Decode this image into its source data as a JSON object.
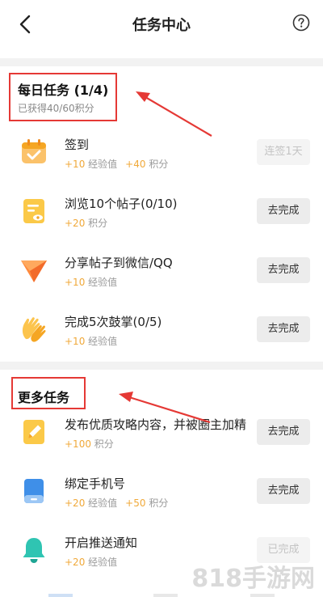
{
  "header": {
    "title": "任务中心"
  },
  "daily": {
    "title": "每日任务 (1/4)",
    "subtitle": "已获得40/60积分",
    "tasks": [
      {
        "name": "签到",
        "r1num": "+10",
        "r1label": "经验值",
        "r2num": "+40",
        "r2label": "积分",
        "button": "连签1天",
        "icon": "calendar-check-icon"
      },
      {
        "name": "浏览10个帖子(0/10)",
        "r1num": "+20",
        "r1label": "积分",
        "button": "去完成",
        "icon": "document-eye-icon"
      },
      {
        "name": "分享帖子到微信/QQ",
        "r1num": "+10",
        "r1label": "经验值",
        "button": "去完成",
        "icon": "paper-plane-icon"
      },
      {
        "name": "完成5次鼓掌(0/5)",
        "r1num": "+10",
        "r1label": "经验值",
        "button": "去完成",
        "icon": "clapping-hands-icon"
      }
    ]
  },
  "more": {
    "title": "更多任务",
    "tasks": [
      {
        "name": "发布优质攻略内容，并被圈主加精",
        "r1num": "+100",
        "r1label": "积分",
        "button": "去完成",
        "icon": "edit-document-icon"
      },
      {
        "name": "绑定手机号",
        "r1num": "+20",
        "r1label": "经验值",
        "r2num": "+50",
        "r2label": "积分",
        "button": "去完成",
        "icon": "phone-icon"
      },
      {
        "name": "开启推送通知",
        "r1num": "+20",
        "r1label": "经验值",
        "button": "已完成",
        "icon": "bell-icon"
      }
    ]
  },
  "watermark": "818手游网",
  "colors": {
    "reward": "#f0a93a",
    "annotation": "#e53935",
    "separator": "#f2f2f2"
  }
}
